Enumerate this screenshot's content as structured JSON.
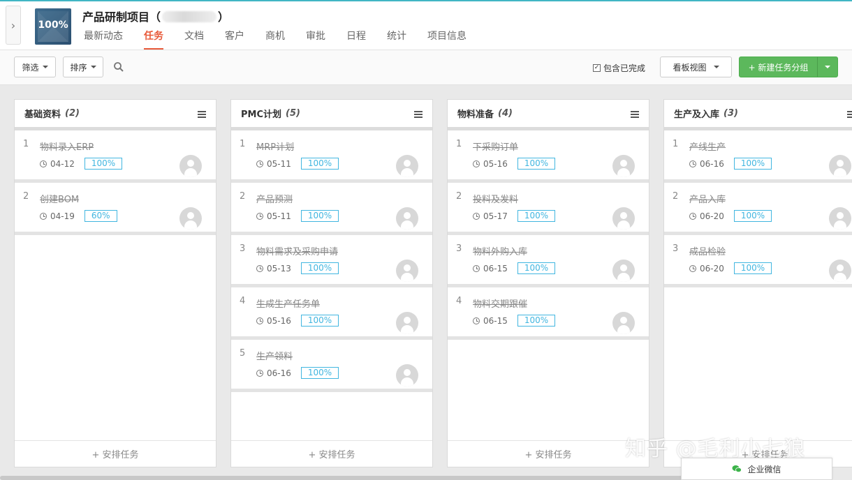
{
  "header": {
    "logo_text": "100%",
    "project_title": "产品研制项目（",
    "project_title_end": "）",
    "tabs": [
      {
        "label": "最新动态"
      },
      {
        "label": "任务"
      },
      {
        "label": "文档"
      },
      {
        "label": "客户"
      },
      {
        "label": "商机"
      },
      {
        "label": "审批"
      },
      {
        "label": "日程"
      },
      {
        "label": "统计"
      },
      {
        "label": "项目信息"
      }
    ],
    "active_tab": "任务",
    "accent_color": "#e85a3a"
  },
  "toolbar": {
    "filter_label": "筛选",
    "sort_label": "排序",
    "include_done_label": "包含已完成",
    "include_done_checked": true,
    "view_label": "看板视图",
    "new_group_label": "+ 新建任务分组"
  },
  "columns": [
    {
      "name": "基础资料",
      "count": "(2)",
      "add_label": "+ 安排任务",
      "cards": [
        {
          "num": "1",
          "title": "物料录入ERP",
          "date": "04-12",
          "progress": "100%"
        },
        {
          "num": "2",
          "title": "创建BOM",
          "date": "04-19",
          "progress": "60%"
        }
      ]
    },
    {
      "name": "PMC计划",
      "count": "(5)",
      "add_label": "+ 安排任务",
      "cards": [
        {
          "num": "1",
          "title": "MRP计划",
          "date": "05-11",
          "progress": "100%"
        },
        {
          "num": "2",
          "title": "产品预测",
          "date": "05-11",
          "progress": "100%"
        },
        {
          "num": "3",
          "title": "物料需求及采购申请",
          "date": "05-13",
          "progress": "100%"
        },
        {
          "num": "4",
          "title": "生成生产任务单",
          "date": "05-16",
          "progress": "100%"
        },
        {
          "num": "5",
          "title": "生产领料",
          "date": "06-16",
          "progress": "100%"
        }
      ]
    },
    {
      "name": "物料准备",
      "count": "(4)",
      "add_label": "+ 安排任务",
      "cards": [
        {
          "num": "1",
          "title": "下采购订单",
          "date": "05-16",
          "progress": "100%"
        },
        {
          "num": "2",
          "title": "投料及发料",
          "date": "05-17",
          "progress": "100%"
        },
        {
          "num": "3",
          "title": "物料外购入库",
          "date": "06-15",
          "progress": "100%"
        },
        {
          "num": "4",
          "title": "物料交期跟催",
          "date": "06-15",
          "progress": "100%"
        }
      ]
    },
    {
      "name": "生产及入库",
      "count": "(3)",
      "add_label": "+ 安排任务",
      "cards": [
        {
          "num": "1",
          "title": "产线生产",
          "date": "06-16",
          "progress": "100%"
        },
        {
          "num": "2",
          "title": "产品入库",
          "date": "06-20",
          "progress": "100%"
        },
        {
          "num": "3",
          "title": "成品检验",
          "date": "06-20",
          "progress": "100%"
        }
      ]
    }
  ],
  "watermark": "知乎 @毛利小七狼",
  "wecom_label": "企业微信",
  "badge_color": "#41b6e0",
  "button_green": "#5cb85c"
}
